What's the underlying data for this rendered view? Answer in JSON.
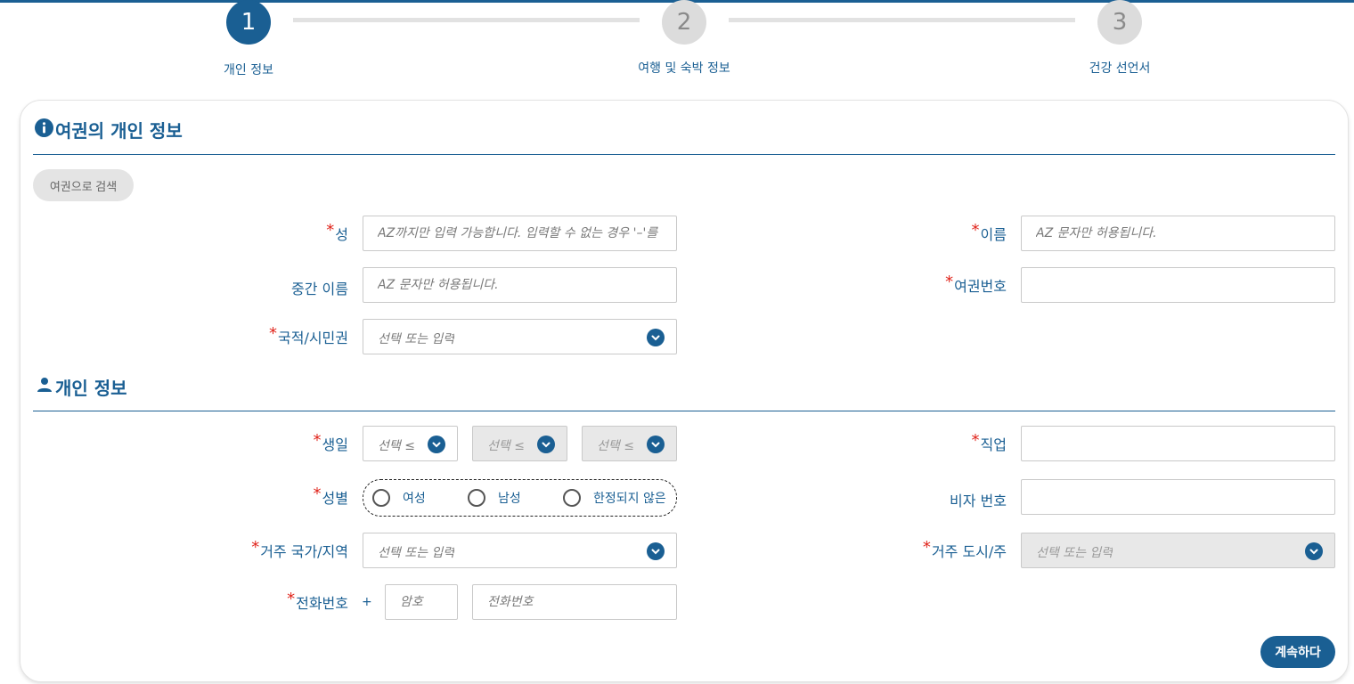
{
  "stepper": {
    "steps": [
      {
        "number": "1",
        "label": "개인 정보",
        "state": "active"
      },
      {
        "number": "2",
        "label": "여행 및 숙박 정보",
        "state": "inactive"
      },
      {
        "number": "3",
        "label": "건강 선언서",
        "state": "inactive"
      }
    ]
  },
  "passport_section": {
    "title": "여권의 개인 정보",
    "icon": "info-icon",
    "search_button": "여권으로 검색",
    "fields": {
      "surname": {
        "label": "성",
        "required": true,
        "placeholder": "AZ까지만 입력 가능합니다. 입력할 수 없는 경우 '–'를",
        "value": ""
      },
      "given_name": {
        "label": "이름",
        "required": true,
        "placeholder": "AZ 문자만 허용됩니다.",
        "value": ""
      },
      "middle_name": {
        "label": "중간 이름",
        "required": false,
        "placeholder": "AZ 문자만 허용됩니다.",
        "value": ""
      },
      "passport_number": {
        "label": "여권번호",
        "required": true,
        "placeholder": "",
        "value": ""
      },
      "nationality": {
        "label": "국적/시민권",
        "required": true,
        "placeholder": "선택 또는 입력"
      }
    }
  },
  "personal_section": {
    "title": "개인 정보",
    "icon": "person-icon",
    "fields": {
      "birthdate": {
        "label": "생일",
        "required": true,
        "selects": [
          "선택 ≤",
          "선택 ≤",
          "선택 ≤"
        ]
      },
      "occupation": {
        "label": "직업",
        "required": true,
        "value": ""
      },
      "gender": {
        "label": "성별",
        "required": true,
        "options": [
          "여성",
          "남성",
          "한정되지 않은"
        ]
      },
      "visa_number": {
        "label": "비자 번호",
        "required": false,
        "value": ""
      },
      "residence_country": {
        "label": "거주 국가/지역",
        "required": true,
        "placeholder": "선택 또는 입력"
      },
      "residence_city": {
        "label": "거주 도시/주",
        "required": true,
        "placeholder": "선택 또는 입력"
      },
      "phone": {
        "label": "전화번호",
        "required": true,
        "prefix": "+",
        "code_placeholder": "암호",
        "number_placeholder": "전화번호"
      }
    }
  },
  "actions": {
    "continue": "계속하다"
  },
  "colors": {
    "primary": "#1a5f93",
    "required": "#e0241b",
    "inactive": "#dcdcdc"
  }
}
